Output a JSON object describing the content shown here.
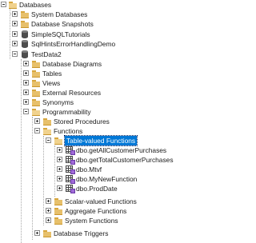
{
  "tree": {
    "rows": [
      {
        "label": "Databases",
        "icon": "folder-open-icon",
        "toggle": "minus"
      },
      {
        "label": "System Databases",
        "icon": "folder-icon",
        "toggle": "plus"
      },
      {
        "label": "Database Snapshots",
        "icon": "folder-icon",
        "toggle": "plus"
      },
      {
        "label": "SimpleSQLTutorials",
        "icon": "database-icon",
        "toggle": "plus"
      },
      {
        "label": "SqlHintsErrorHandlingDemo",
        "icon": "database-icon",
        "toggle": "plus"
      },
      {
        "label": "TestData2",
        "icon": "database-icon",
        "toggle": "minus"
      },
      {
        "label": "Database Diagrams",
        "icon": "folder-icon",
        "toggle": "plus"
      },
      {
        "label": "Tables",
        "icon": "folder-icon",
        "toggle": "plus"
      },
      {
        "label": "Views",
        "icon": "folder-icon",
        "toggle": "plus"
      },
      {
        "label": "External Resources",
        "icon": "folder-icon",
        "toggle": "plus"
      },
      {
        "label": "Synonyms",
        "icon": "folder-icon",
        "toggle": "plus"
      },
      {
        "label": "Programmability",
        "icon": "folder-open-icon",
        "toggle": "minus"
      },
      {
        "label": "Stored Procedures",
        "icon": "folder-icon",
        "toggle": "plus"
      },
      {
        "label": "Functions",
        "icon": "folder-open-icon",
        "toggle": "minus"
      },
      {
        "label": "Table-valued Functions",
        "icon": "folder-open-icon",
        "toggle": "minus",
        "selected": true
      },
      {
        "label": "dbo.getAllCustomerPurchases",
        "icon": "table-valued-function-icon",
        "toggle": "plus"
      },
      {
        "label": "dbo.getTotalCustomerPurchases",
        "icon": "table-valued-function-icon",
        "toggle": "plus"
      },
      {
        "label": "dbo.Mtvf",
        "icon": "table-valued-function-icon",
        "toggle": "plus"
      },
      {
        "label": "dbo.MyNewFunction",
        "icon": "table-valued-function-icon",
        "toggle": "plus"
      },
      {
        "label": "dbo.ProdDate",
        "icon": "table-valued-function-icon",
        "toggle": "plus"
      },
      {
        "label": "Scalar-valued Functions",
        "icon": "folder-icon",
        "toggle": "plus"
      },
      {
        "label": "Aggregate Functions",
        "icon": "folder-icon",
        "toggle": "plus"
      },
      {
        "label": "System Functions",
        "icon": "folder-icon",
        "toggle": "plus"
      },
      {
        "label": "Database Triggers",
        "icon": "folder-icon",
        "toggle": "plus"
      }
    ]
  }
}
